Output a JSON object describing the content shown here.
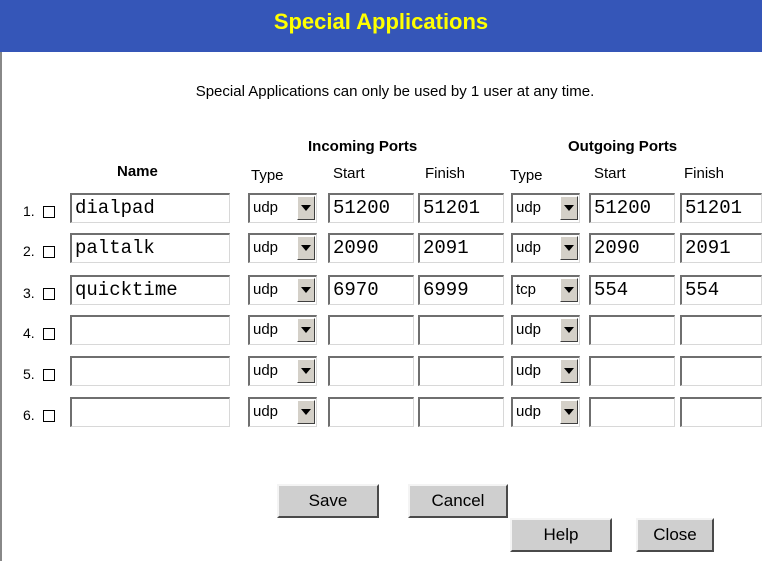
{
  "header": {
    "title": "Special Applications"
  },
  "intro": "Special Applications can only be used by 1 user at any time.",
  "table": {
    "incoming_group": "Incoming Ports",
    "outgoing_group": "Outgoing Ports",
    "col_name": "Name",
    "col_type": "Type",
    "col_start": "Start",
    "col_finish": "Finish",
    "rows": [
      {
        "num": "1.",
        "name": "dialpad",
        "in_type": "udp",
        "in_start": "51200",
        "in_finish": "51201",
        "out_type": "udp",
        "out_start": "51200",
        "out_finish": "51201"
      },
      {
        "num": "2.",
        "name": "paltalk",
        "in_type": "udp",
        "in_start": "2090",
        "in_finish": "2091",
        "out_type": "udp",
        "out_start": "2090",
        "out_finish": "2091"
      },
      {
        "num": "3.",
        "name": "quicktime",
        "in_type": "udp",
        "in_start": "6970",
        "in_finish": "6999",
        "out_type": "tcp",
        "out_start": "554",
        "out_finish": "554"
      },
      {
        "num": "4.",
        "name": "",
        "in_type": "udp",
        "in_start": "",
        "in_finish": "",
        "out_type": "udp",
        "out_start": "",
        "out_finish": ""
      },
      {
        "num": "5.",
        "name": "",
        "in_type": "udp",
        "in_start": "",
        "in_finish": "",
        "out_type": "udp",
        "out_start": "",
        "out_finish": ""
      },
      {
        "num": "6.",
        "name": "",
        "in_type": "udp",
        "in_start": "",
        "in_finish": "",
        "out_type": "udp",
        "out_start": "",
        "out_finish": ""
      }
    ]
  },
  "buttons": {
    "save": "Save",
    "cancel": "Cancel",
    "help": "Help",
    "close": "Close"
  }
}
